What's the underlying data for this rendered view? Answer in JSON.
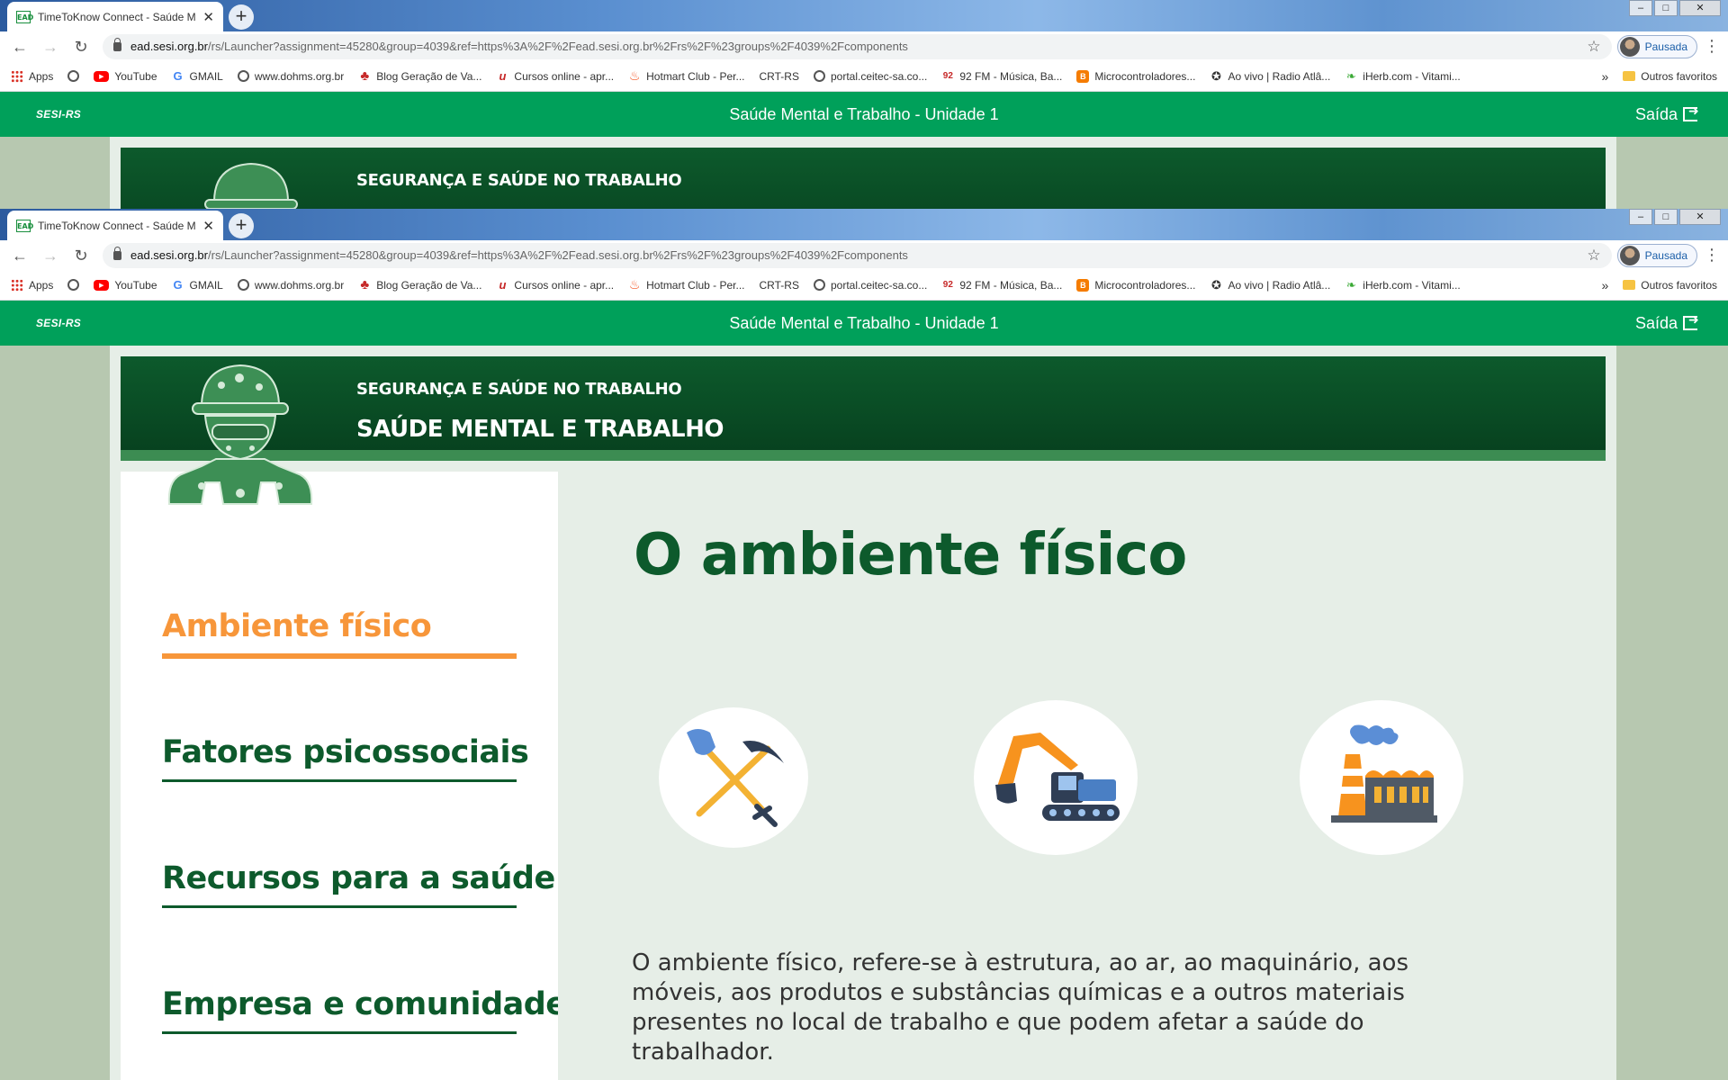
{
  "browser": {
    "tab_title": "TimeToKnow Connect - Saúde M",
    "tab_favicon": "EAD",
    "new_tab": "+",
    "url_host": "ead.sesi.org.br",
    "url_path": "/rs/Launcher?assignment=45280&group=4039&ref=https%3A%2F%2Fead.sesi.org.br%2Frs%2F%23groups%2F4039%2Fcomponents",
    "profile_label": "Pausada",
    "bookmarks": [
      "Apps",
      "YouTube",
      "GMAIL",
      "www.dohms.org.br",
      "Blog Geração de Va...",
      "Cursos online - apr...",
      "Hotmart Club - Per...",
      "CRT-RS",
      "portal.ceitec-sa.co...",
      "92 FM - Música, Ba...",
      "Microcontroladores...",
      "Ao vivo | Radio Atlâ...",
      "iHerb.com - Vitami..."
    ],
    "bookmark_icons": [
      "apps-grid-icon",
      "globe-icon",
      "youtube-icon",
      "google-icon",
      "globe-icon",
      "club-icon",
      "cursos-icon",
      "hotmart-flame-icon",
      "none",
      "globe-icon",
      "radio-92-icon",
      "blogger-icon",
      "owl-icon",
      "leaf-icon"
    ],
    "bookmarks_more": "»",
    "other_bookmarks": "Outros favoritos"
  },
  "app": {
    "logo": "SESI-RS",
    "title": "Saúde Mental e Trabalho - Unidade 1",
    "exit_label": "Saída"
  },
  "banner": {
    "subtitle": "SEGURANÇA E SAÚDE NO TRABALHO",
    "title": "SAÚDE MENTAL E TRABALHO"
  },
  "nav": {
    "items": [
      "Ambiente físico",
      "Fatores psicossociais",
      "Recursos para a saúde",
      "Empresa e comunidade"
    ],
    "active_index": 0
  },
  "content": {
    "heading": "O ambiente físico",
    "icons": [
      "shovel-pickaxe-icon",
      "excavator-icon",
      "factory-icon"
    ],
    "paragraph": "O ambiente físico, refere-se à estrutura, ao ar, ao maquinário, aos móveis, aos produtos e substâncias químicas e a outros materiais presentes no local de trabalho e que podem afetar a saúde do trabalhador."
  },
  "colors": {
    "header_green": "#00a05a",
    "banner_dark_green": "#0d5a2c",
    "active_orange": "#f7963a",
    "content_bg": "#e6eee7"
  }
}
